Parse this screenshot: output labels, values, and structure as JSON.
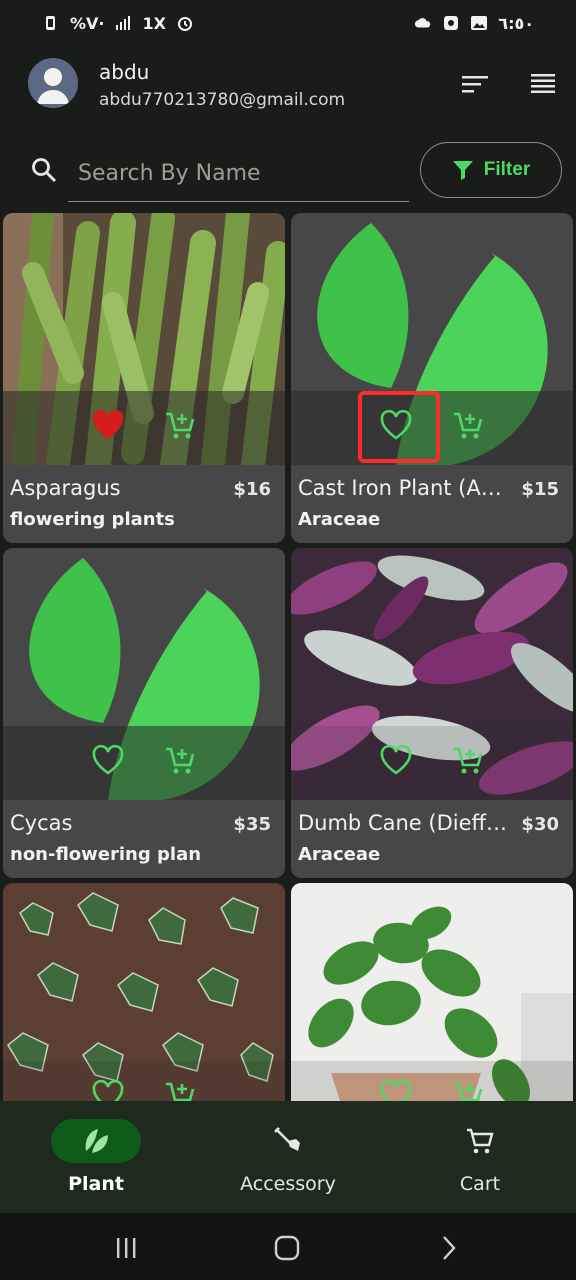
{
  "status_bar": {
    "left_text": "%V·",
    "speed": "1X",
    "time": "٦:٥٠"
  },
  "user": {
    "name": "abdu",
    "email": "abdu770213780@gmail.com"
  },
  "search": {
    "placeholder": "Search By Name"
  },
  "filter": {
    "label": "Filter"
  },
  "colors": {
    "accent": "#4cd964",
    "active_pill": "#0d5c1a",
    "favorite_active": "#d61c1c",
    "highlight_box": "#ff2a2a"
  },
  "products": [
    {
      "name": "Asparagus",
      "price": "$16",
      "category": "flowering plants",
      "favorite": true,
      "image": "asparagus-photo"
    },
    {
      "name": "Cast Iron Plant (Asp...",
      "price": "$15",
      "category": "Araceae",
      "favorite": false,
      "image": "leaf-placeholder",
      "highlighted_favorite": true
    },
    {
      "name": "Cycas",
      "price": "$35",
      "category": "non-flowering plan",
      "favorite": false,
      "image": "leaf-placeholder"
    },
    {
      "name": "Dumb Cane (Dieffen...",
      "price": "$30",
      "category": "Araceae",
      "favorite": false,
      "image": "tradescantia-photo"
    },
    {
      "name": "",
      "price": "",
      "category": "",
      "favorite": false,
      "image": "ivy-photo"
    },
    {
      "name": "",
      "price": "",
      "category": "",
      "favorite": false,
      "image": "pothos-photo"
    }
  ],
  "bottom_nav": [
    {
      "label": "Plant",
      "icon": "leaf-icon",
      "active": true
    },
    {
      "label": "Accessory",
      "icon": "shovel-icon",
      "active": false
    },
    {
      "label": "Cart",
      "icon": "cart-icon",
      "active": false
    }
  ]
}
